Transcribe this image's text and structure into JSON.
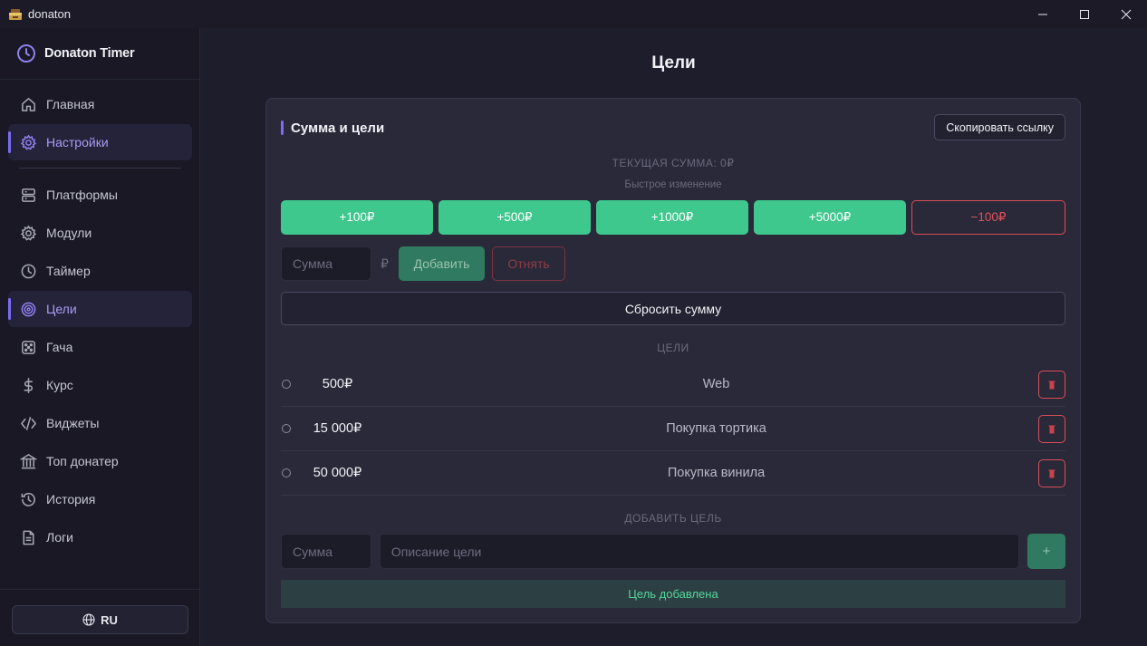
{
  "window": {
    "title": "donaton",
    "controls": {
      "minimize": "minimize-icon",
      "maximize": "maximize-icon",
      "close": "close-icon"
    }
  },
  "sidebar": {
    "brand": "Donaton Timer",
    "items": [
      {
        "label": "Главная",
        "icon": "home-icon",
        "active": false
      },
      {
        "label": "Настройки",
        "icon": "gear-icon",
        "active": true
      },
      {
        "label": "Платформы",
        "icon": "server-icon",
        "active": false
      },
      {
        "label": "Модули",
        "icon": "cog-icon",
        "active": false
      },
      {
        "label": "Таймер",
        "icon": "clock-icon",
        "active": false
      },
      {
        "label": "Цели",
        "icon": "target-icon",
        "active": true
      },
      {
        "label": "Гача",
        "icon": "dice-icon",
        "active": false
      },
      {
        "label": "Курс",
        "icon": "dollar-icon",
        "active": false
      },
      {
        "label": "Виджеты",
        "icon": "code-icon",
        "active": false
      },
      {
        "label": "Топ донатер",
        "icon": "pillars-icon",
        "active": false
      },
      {
        "label": "История",
        "icon": "history-icon",
        "active": false
      },
      {
        "label": "Логи",
        "icon": "document-icon",
        "active": false
      }
    ],
    "language": "RU"
  },
  "main": {
    "title": "Цели",
    "section_title": "Сумма и цели",
    "copy_link": "Скопировать ссылку",
    "current_sum": "ТЕКУЩАЯ СУММА: 0₽",
    "quick_change_label": "Быстрое изменение",
    "quick_buttons": [
      "+100₽",
      "+500₽",
      "+1000₽",
      "+5000₽",
      "−100₽"
    ],
    "sum_placeholder": "Сумма",
    "currency": "₽",
    "add_label": "Добавить",
    "subtract_label": "Отнять",
    "reset_label": "Сбросить сумму",
    "goals_label": "ЦЕЛИ",
    "goals": [
      {
        "amount": "500₽",
        "description": "Web"
      },
      {
        "amount": "15 000₽",
        "description": "Покупка тортика"
      },
      {
        "amount": "50 000₽",
        "description": "Покупка винила"
      }
    ],
    "add_goal_label": "ДОБАВИТЬ ЦЕЛЬ",
    "goal_sum_placeholder": "Сумма",
    "goal_desc_placeholder": "Описание цели",
    "plus_label": "+",
    "notice": "Цель добавлена"
  },
  "colors": {
    "accent": "#7c6cf0",
    "success": "#3fc88e",
    "danger": "#d84d57",
    "background": "#1e1d2b"
  }
}
